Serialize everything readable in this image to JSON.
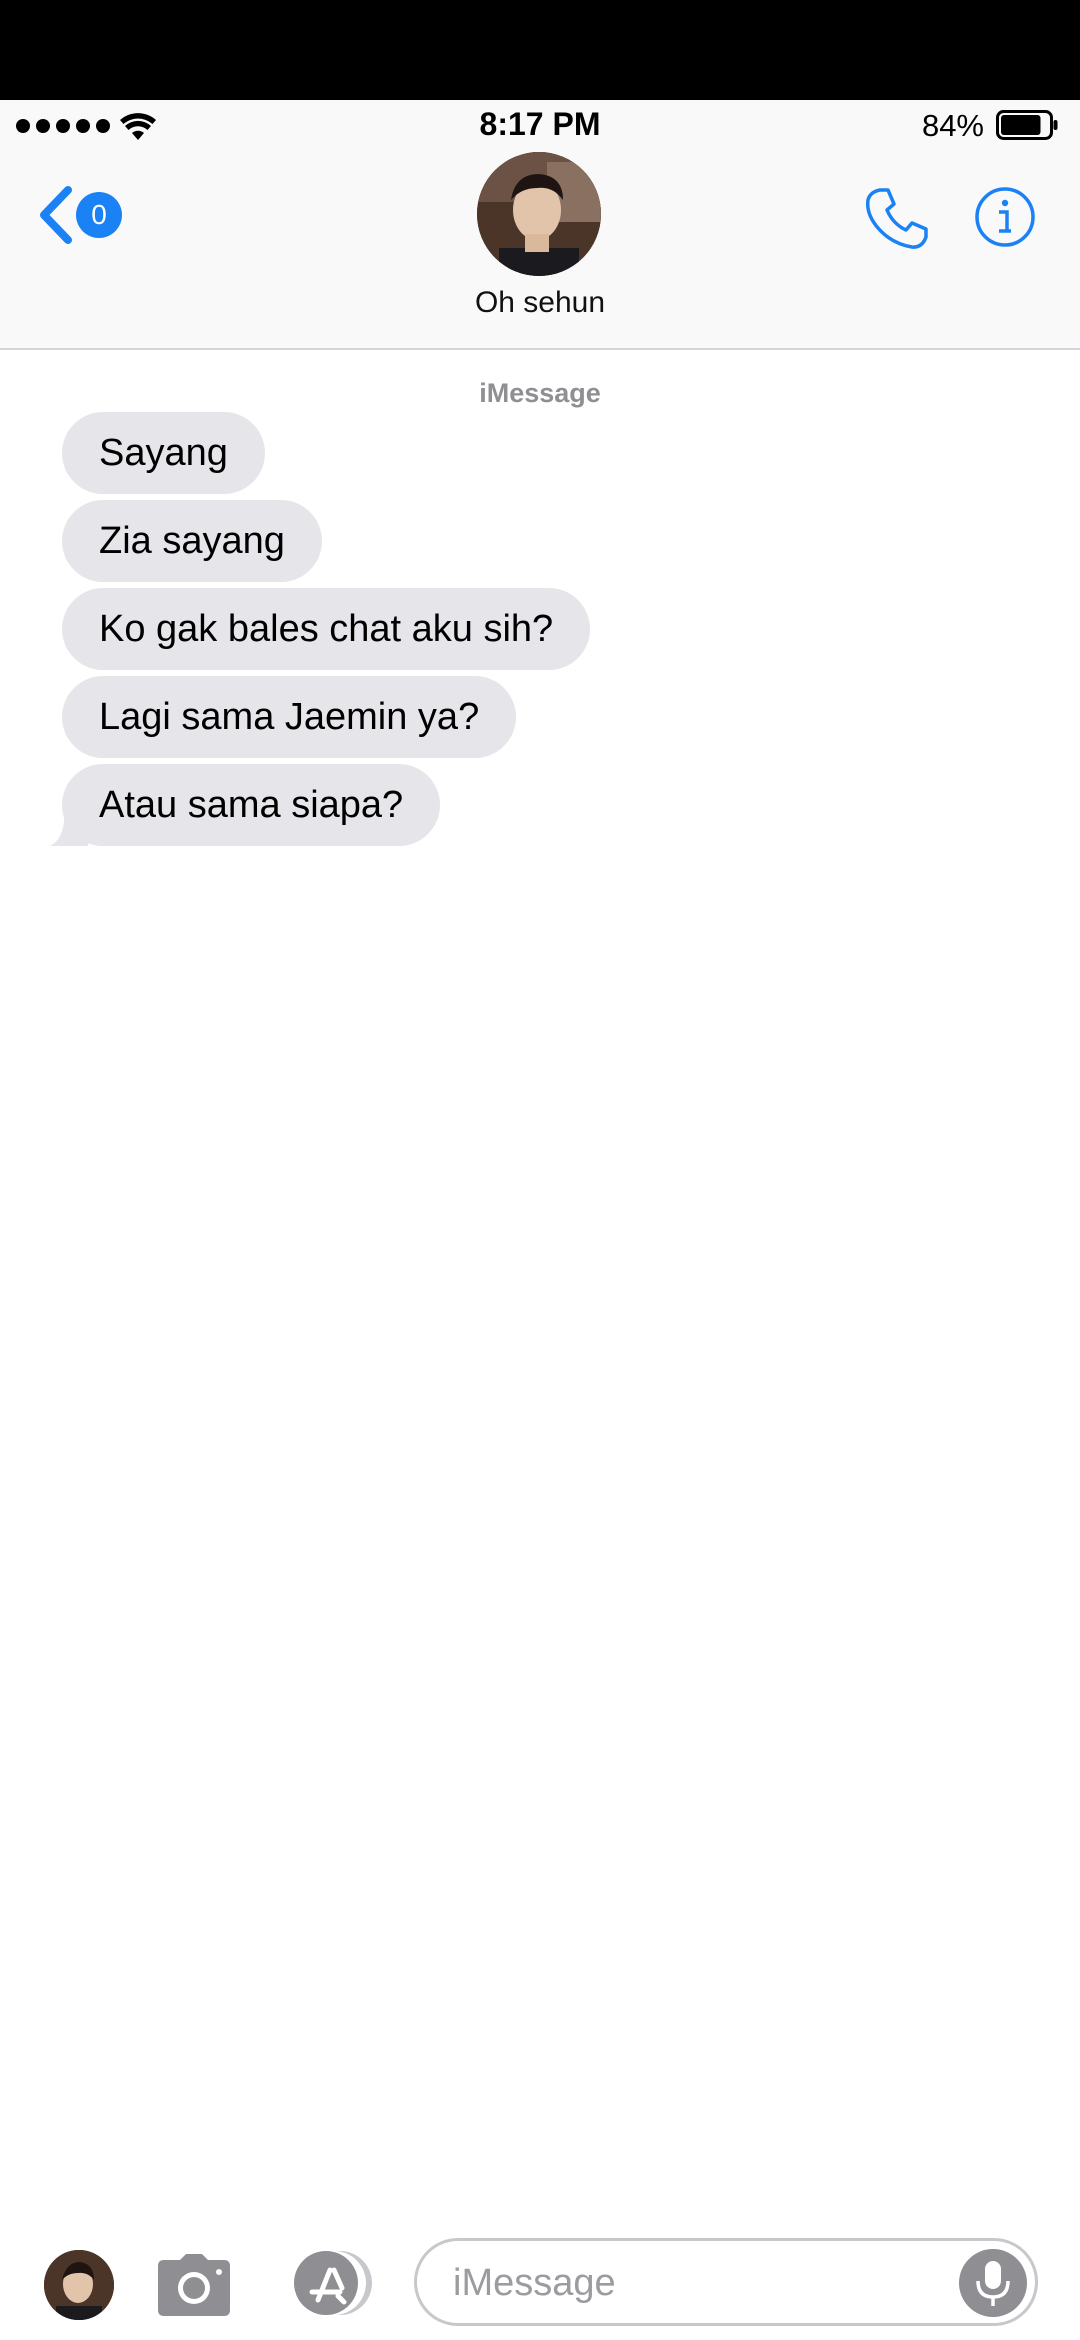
{
  "status_bar": {
    "time": "8:17 PM",
    "battery_percent": "84%",
    "battery_level": 0.84,
    "signal_bars": 5
  },
  "header": {
    "back_badge": "0",
    "contact_name": "Oh sehun",
    "icons": {
      "back": "chevron-left-icon",
      "call": "phone-icon",
      "info": "info-icon"
    }
  },
  "conversation": {
    "service_label": "iMessage",
    "messages": [
      {
        "text": "Sayang"
      },
      {
        "text": "Zia sayang"
      },
      {
        "text": "Ko gak bales chat aku sih?"
      },
      {
        "text": "Lagi sama Jaemin ya?"
      },
      {
        "text": "Atau sama siapa?"
      }
    ]
  },
  "input_bar": {
    "placeholder": "iMessage",
    "icons": {
      "camera": "camera-icon",
      "apps": "app-store-icon",
      "mic": "microphone-icon"
    }
  },
  "colors": {
    "accent": "#1a82f4",
    "bubble_received": "#e5e5ea",
    "secondary_text": "#8e8e93"
  }
}
